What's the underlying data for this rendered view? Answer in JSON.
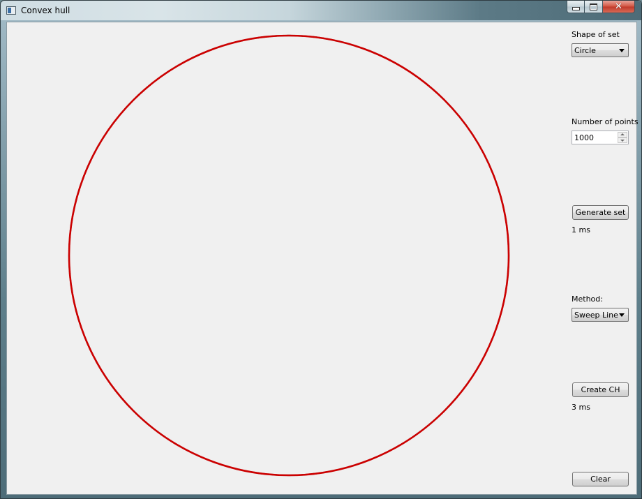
{
  "window": {
    "title": "Convex hull"
  },
  "panel": {
    "shape_label": "Shape of set",
    "shape_value": "Circle",
    "points_label": "Number of points",
    "points_value": "1000",
    "generate_label": "Generate set",
    "generate_time": "1 ms",
    "method_label": "Method:",
    "method_value": "Sweep Line",
    "create_label": "Create CH",
    "create_time": "3 ms",
    "clear_label": "Clear"
  },
  "canvas": {
    "hull_color": "#cc0000",
    "points_color": "#222222",
    "point_count": 1000
  }
}
